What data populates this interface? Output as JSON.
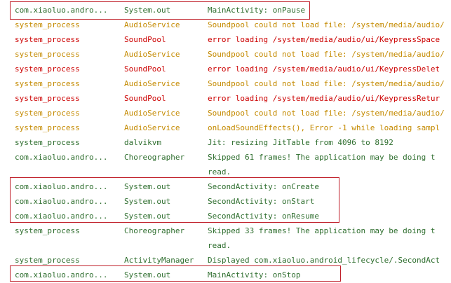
{
  "log": {
    "rows": [
      {
        "level": "i",
        "app": "com.xiaoluo.andro...",
        "tag": "System.out",
        "msg": "MainActivity: onPause"
      },
      {
        "level": "w",
        "app": "system_process",
        "tag": "AudioService",
        "msg": "Soundpool could not load file: /system/media/audio/"
      },
      {
        "level": "e",
        "app": "system_process",
        "tag": "SoundPool",
        "msg": "error loading /system/media/audio/ui/KeypressSpace"
      },
      {
        "level": "w",
        "app": "system_process",
        "tag": "AudioService",
        "msg": "Soundpool could not load file: /system/media/audio/"
      },
      {
        "level": "e",
        "app": "system_process",
        "tag": "SoundPool",
        "msg": "error loading /system/media/audio/ui/KeypressDelet"
      },
      {
        "level": "w",
        "app": "system_process",
        "tag": "AudioService",
        "msg": "Soundpool could not load file: /system/media/audio/"
      },
      {
        "level": "e",
        "app": "system_process",
        "tag": "SoundPool",
        "msg": "error loading /system/media/audio/ui/KeypressRetur"
      },
      {
        "level": "w",
        "app": "system_process",
        "tag": "AudioService",
        "msg": "Soundpool could not load file: /system/media/audio/"
      },
      {
        "level": "w",
        "app": "system_process",
        "tag": "AudioService",
        "msg": "onLoadSoundEffects(), Error -1 while loading sampl"
      },
      {
        "level": "i",
        "app": "system_process",
        "tag": "dalvikvm",
        "msg": "Jit: resizing JitTable from 4096 to 8192"
      },
      {
        "level": "i",
        "app": "com.xiaoluo.andro...",
        "tag": "Choreographer",
        "msg": "Skipped 61 frames!  The application may be doing t"
      },
      {
        "level": "i",
        "app": "",
        "tag": "",
        "msg": "read."
      },
      {
        "level": "i",
        "app": "com.xiaoluo.andro...",
        "tag": "System.out",
        "msg": "SecondActivity: onCreate"
      },
      {
        "level": "i",
        "app": "com.xiaoluo.andro...",
        "tag": "System.out",
        "msg": "SecondActivity: onStart"
      },
      {
        "level": "i",
        "app": "com.xiaoluo.andro...",
        "tag": "System.out",
        "msg": "SecondActivity: onResume"
      },
      {
        "level": "i",
        "app": "system_process",
        "tag": "Choreographer",
        "msg": "Skipped 33 frames!  The application may be doing t"
      },
      {
        "level": "i",
        "app": "",
        "tag": "",
        "msg": "read."
      },
      {
        "level": "i",
        "app": "system_process",
        "tag": "ActivityManager",
        "msg": "Displayed com.xiaoluo.android_lifecycle/.SecondAct"
      },
      {
        "level": "i",
        "app": "com.xiaoluo.andro...",
        "tag": "System.out",
        "msg": "MainActivity: onStop"
      }
    ]
  },
  "colors": {
    "info": "#2e6e2e",
    "warn": "#c48a00",
    "error": "#cc0000",
    "highlight": "#c0202a"
  }
}
